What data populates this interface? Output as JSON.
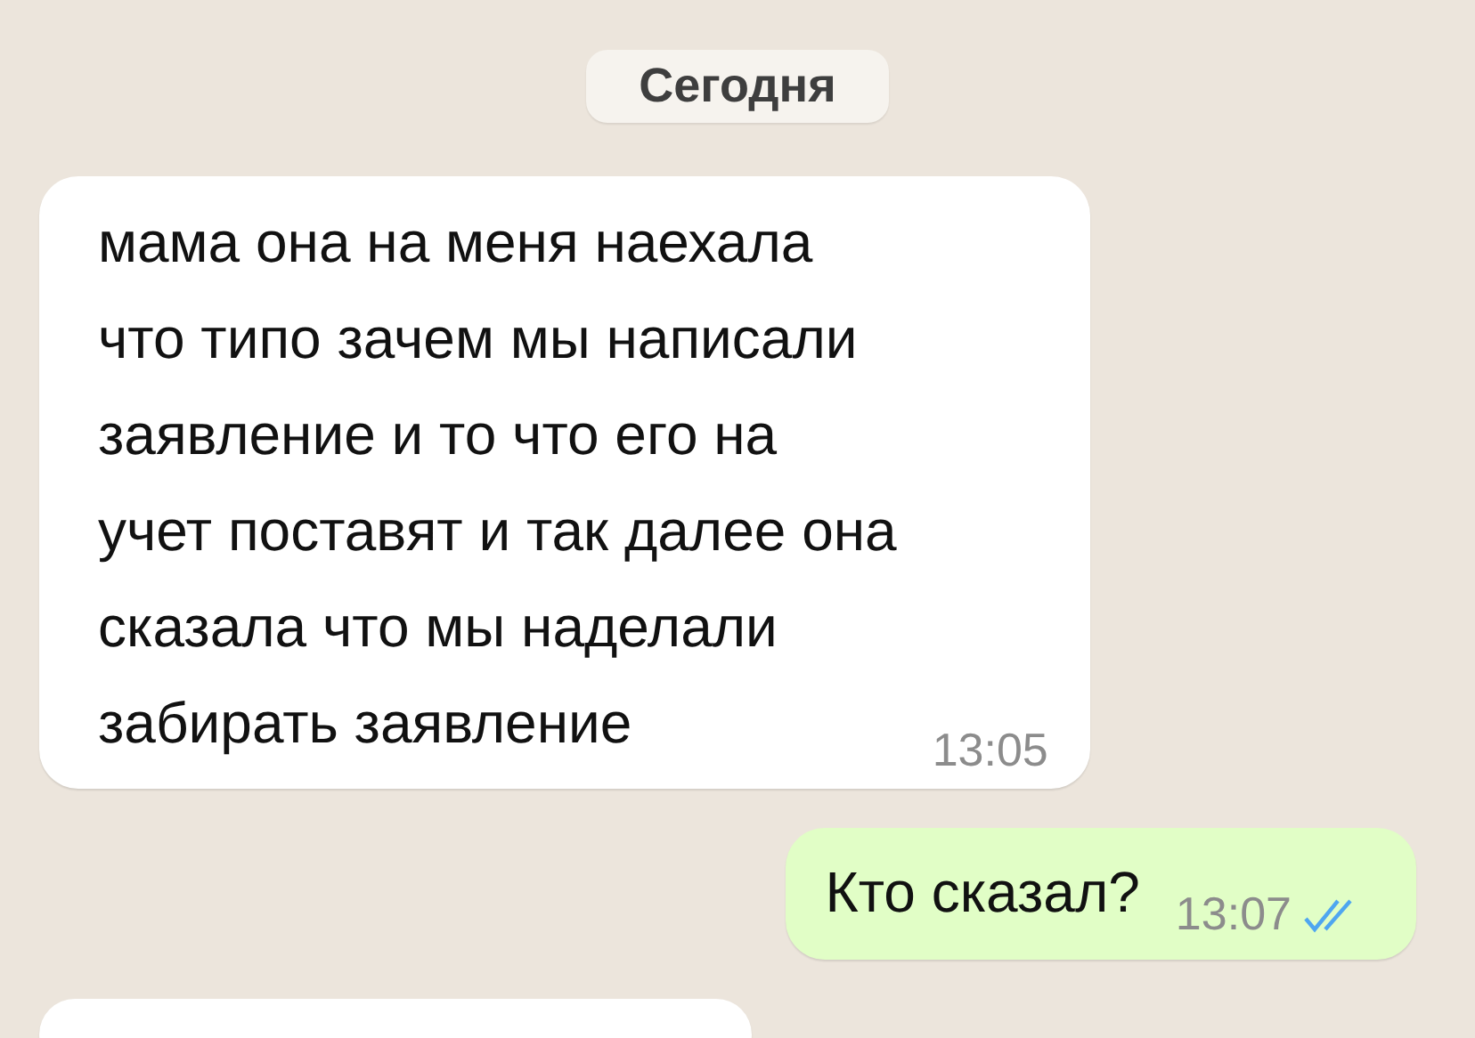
{
  "date_separator": "Сегодня",
  "messages": [
    {
      "kind": "in",
      "lines": [
        "мама она на меня наехала",
        "что типо зачем мы написали",
        "заявление и то что его на",
        "учет поставят и так далее она",
        "сказала что мы наделали",
        "забирать заявление"
      ],
      "time": "13:05"
    },
    {
      "kind": "out",
      "lines": [
        "Кто сказал?"
      ],
      "time": "13:07",
      "read": true
    },
    {
      "kind": "in"
    }
  ]
}
